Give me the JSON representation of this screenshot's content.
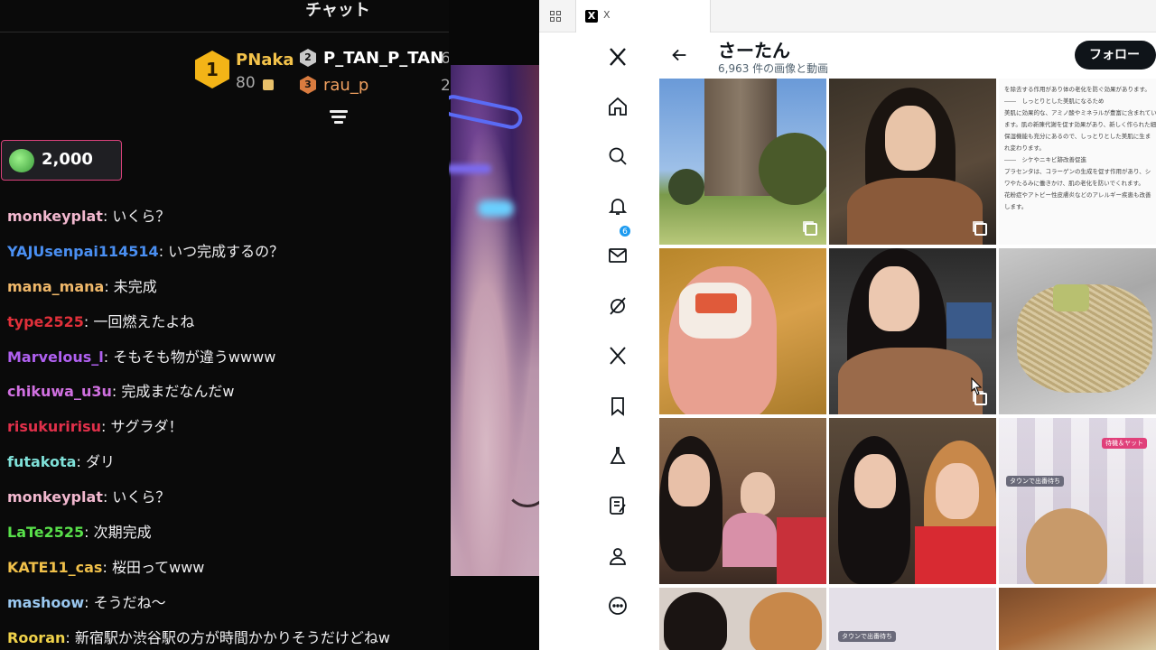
{
  "chat": {
    "title": "チャット",
    "leaderboard": [
      {
        "rank": "1",
        "name": "PNaka",
        "points": "80",
        "color": "#f3b417",
        "gift_icon": "gift-icon"
      },
      {
        "rank": "2",
        "name": "P_TAN_P_TAN",
        "points": "6",
        "color": "#c9c9c9"
      },
      {
        "rank": "3",
        "name": "rau_p",
        "points": "2",
        "color": "#d97b3f"
      }
    ],
    "pinned": {
      "amount": "2,000",
      "icon": "cheer-icon"
    },
    "messages": [
      {
        "user": "monkeyplat",
        "text": "いくら？",
        "color": "#f2b8cf"
      },
      {
        "user": "YAJUsenpai114514",
        "text": "いつ完成するの？",
        "color": "#4a8ff2"
      },
      {
        "user": "mana_mana",
        "text": "未完成",
        "color": "#f0b86a"
      },
      {
        "user": "type2525",
        "text": "一回燃えたよね",
        "color": "#e0303a"
      },
      {
        "user": "Marvelous_l",
        "text": "そもそも物が違うwwww",
        "color": "#b060f0"
      },
      {
        "user": "chikuwa_u3u",
        "text": "完成まだなんだw",
        "color": "#d070e0"
      },
      {
        "user": "risukuririsu",
        "text": "サグラダ！",
        "color": "#e0304a"
      },
      {
        "user": "futakota",
        "text": "ダリ",
        "color": "#7fe0d8"
      },
      {
        "user": "monkeyplat",
        "text": "いくら？",
        "color": "#f2b8cf"
      },
      {
        "user": "LaTe2525",
        "text": "次期完成",
        "color": "#58e04a"
      },
      {
        "user": "KATE11_cas",
        "text": "桜田ってwww",
        "color": "#f0c04a"
      },
      {
        "user": "mashoow",
        "text": "そうだね〜",
        "color": "#9ac8f0"
      },
      {
        "user": "Rooran",
        "text": "新宿駅か渋谷駅の方が時間かかりそうだけどねw",
        "color": "#f0d24a"
      }
    ]
  },
  "browser": {
    "tab_label": "X",
    "favicon": "X",
    "nav_badge": "6",
    "profile": {
      "name": "さーたん",
      "count": "6,963 件の画像と動画",
      "follow_label": "フォロー"
    },
    "doc_tile": {
      "lines": [
        "を除去する作用があり体の老化を防ぐ効果があります。",
        "――　しっとりとした美肌になるため",
        "美肌に効果的な、アミノ酸やミネラルが豊富に含まれてい",
        "ます。肌の新陳代謝を促す効果があり、新しく作られた細胞には",
        "保湿機能も充分にあるので、しっとりとした美肌に生ま",
        "れ変わります。",
        "――　シケやニキビ跡改善促進",
        "プラセンタは、コラーゲンの生成を促す作用があり、シ",
        "ワやたるみに働きかけ、肌の老化を防いでくれます。",
        "花粉症やアトピー性皮膚炎などのアレルギー疾患も改善",
        "します。"
      ]
    },
    "tile_captions": {
      "tile9_label": "タウンで出番待ち",
      "tile9_badge": "待機＆ヤット",
      "tile11_label": "タウンで出番待ち"
    }
  }
}
